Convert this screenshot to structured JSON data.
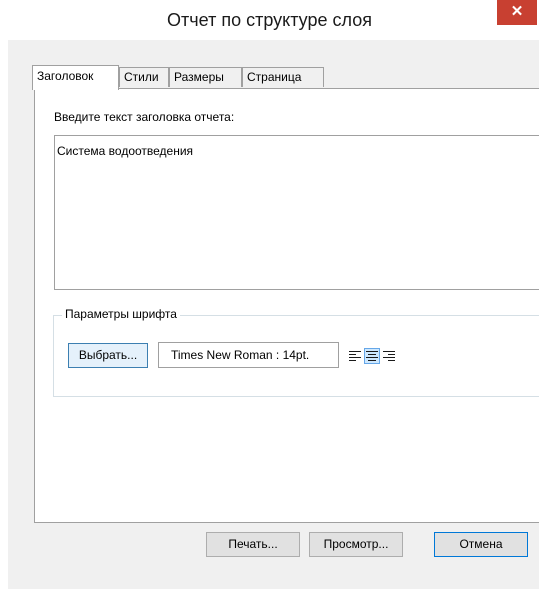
{
  "window": {
    "title": "Отчет по структуре слоя",
    "close_glyph": "✕"
  },
  "tabs": [
    {
      "label": "Заголовок",
      "active": true
    },
    {
      "label": "Стили",
      "active": false
    },
    {
      "label": "Размеры",
      "active": false
    },
    {
      "label": "Страница",
      "active": false
    }
  ],
  "header_panel": {
    "prompt": "Введите текст заголовка отчета:",
    "title_text": "Система водоотведения",
    "font_group": {
      "label": "Параметры шрифта",
      "choose_button": "Выбрать...",
      "font_value": "Times New Roman : 14pt.",
      "alignments": [
        {
          "icon": "align-left-icon",
          "selected": false
        },
        {
          "icon": "align-center-icon",
          "selected": true
        },
        {
          "icon": "align-right-icon",
          "selected": false
        }
      ]
    }
  },
  "footer": {
    "print_button": "Печать...",
    "preview_button": "Просмотр...",
    "cancel_button": "Отмена"
  },
  "colors": {
    "close_button": "#c84031",
    "focus_border": "#0078d7",
    "selected_align_bg": "#cde8ff"
  }
}
